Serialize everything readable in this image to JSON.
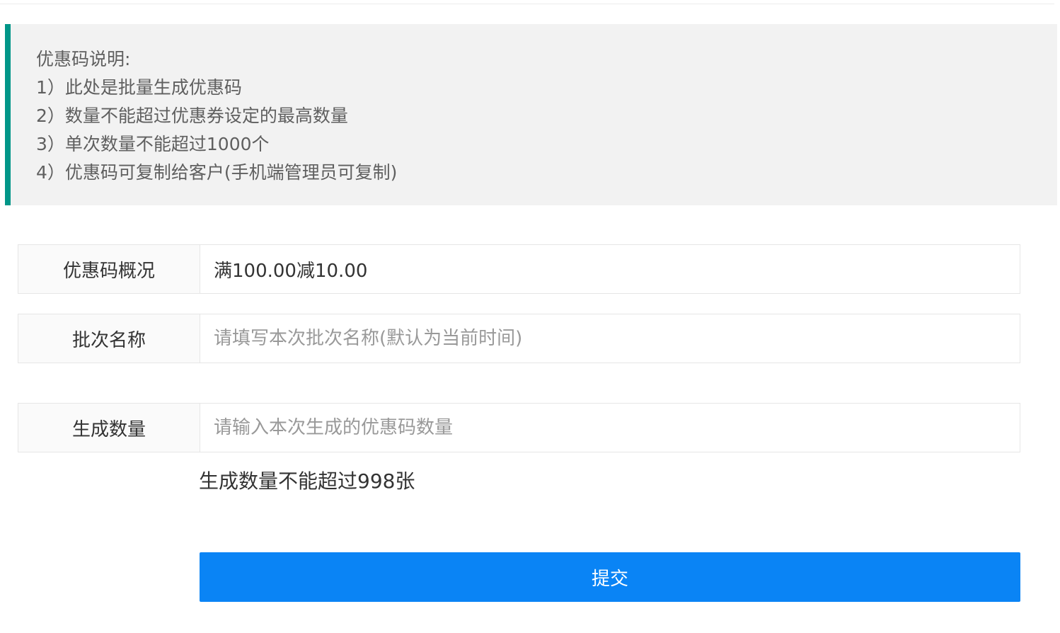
{
  "notice": {
    "title": "优惠码说明:",
    "lines": [
      "1）此处是批量生成优惠码",
      "2）数量不能超过优惠券设定的最高数量",
      "3）单次数量不能超过1000个",
      "4）优惠码可复制给客户(手机端管理员可复制)"
    ]
  },
  "form": {
    "overview": {
      "label": "优惠码概况",
      "value": "满100.00减10.00"
    },
    "batch_name": {
      "label": "批次名称",
      "value": "",
      "placeholder": "请填写本次批次名称(默认为当前时间)"
    },
    "quantity": {
      "label": "生成数量",
      "value": "",
      "placeholder": "请输入本次生成的优惠码数量"
    },
    "quantity_hint": "生成数量不能超过998张",
    "submit_label": "提交"
  },
  "colors": {
    "accent_border": "#009688",
    "notice_bg": "#f2f2f2",
    "submit_bg": "#0a84f5"
  }
}
